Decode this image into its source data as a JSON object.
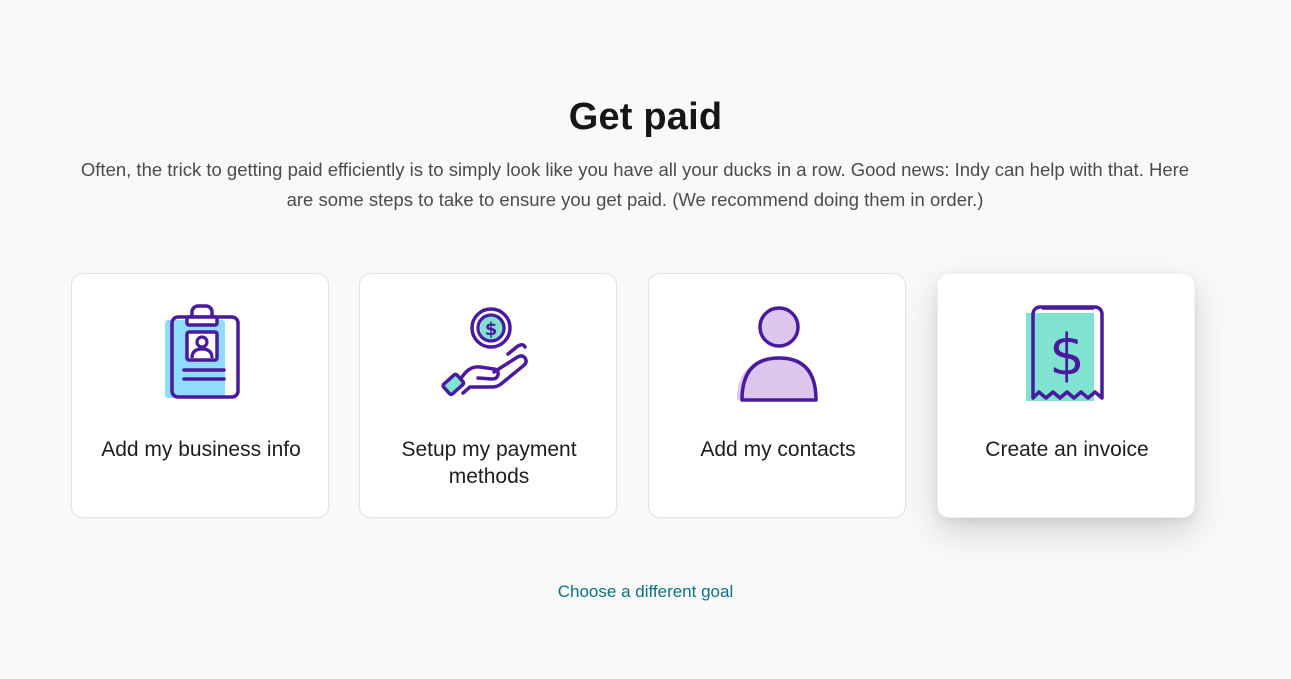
{
  "page": {
    "title": "Get paid",
    "subtitle": "Often, the trick to getting paid efficiently is to simply look like you have all your ducks in a row. Good news: Indy can help with that. Here are some steps to take to ensure you get paid. (We recommend doing them in order.)"
  },
  "cards": [
    {
      "label": "Add my business info",
      "icon": "clipboard-id-icon"
    },
    {
      "label": "Setup my payment methods",
      "icon": "hand-coin-icon"
    },
    {
      "label": "Add my contacts",
      "icon": "person-icon"
    },
    {
      "label": "Create an invoice",
      "icon": "receipt-dollar-icon"
    }
  ],
  "footer": {
    "link_label": "Choose a different goal"
  },
  "colors": {
    "outline": "#4a1a9e",
    "teal": "#7fe3cf",
    "lightblue": "#8fdcff",
    "lavender": "#dcc6ee",
    "link": "#0b7285"
  }
}
